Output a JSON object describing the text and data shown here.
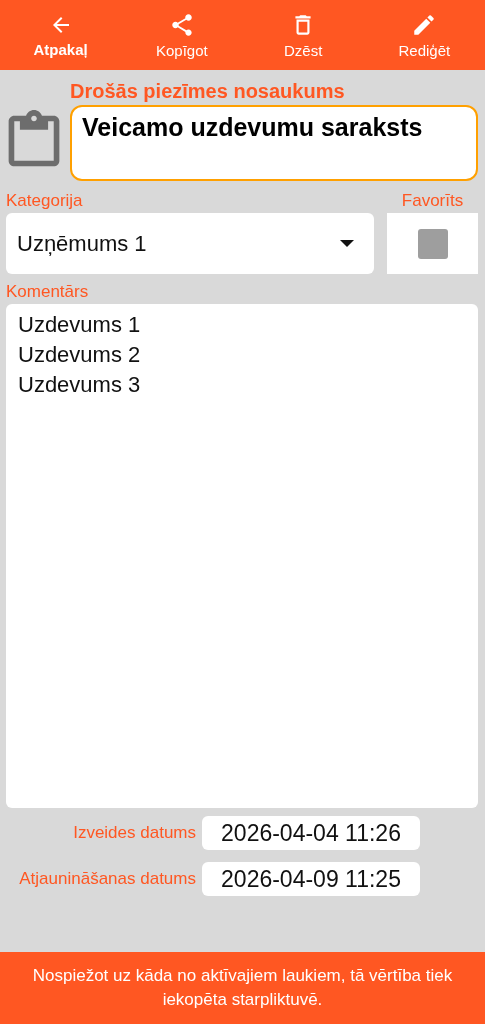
{
  "toolbar": [
    {
      "kind": "back",
      "label": "Atpakaļ",
      "selected": true
    },
    {
      "kind": "share",
      "label": "Kopīgot",
      "selected": false
    },
    {
      "kind": "delete",
      "label": "Dzēst",
      "selected": false
    },
    {
      "kind": "edit",
      "label": "Rediģēt",
      "selected": false
    }
  ],
  "title_field": {
    "label": "Drošās piezīmes nosaukums",
    "value": "Veicamo uzdevumu saraksts"
  },
  "category": {
    "label": "Kategorija",
    "value": "Uzņēmums 1"
  },
  "favorite": {
    "label": "Favorīts",
    "checked": false
  },
  "comment": {
    "label": "Komentārs",
    "lines": [
      "Uzdevums 1",
      "Uzdevums 2",
      "Uzdevums 3"
    ]
  },
  "dates": [
    {
      "label": "Izveides datums",
      "value": "2026-04-04 11:26"
    },
    {
      "label": "Atjaunināšanas datums",
      "value": "2026-04-09 11:25"
    }
  ],
  "footer": "Nospiežot uz kāda no aktīvajiem laukiem, tā vērtība tiek iekopēta starpliktuvē."
}
